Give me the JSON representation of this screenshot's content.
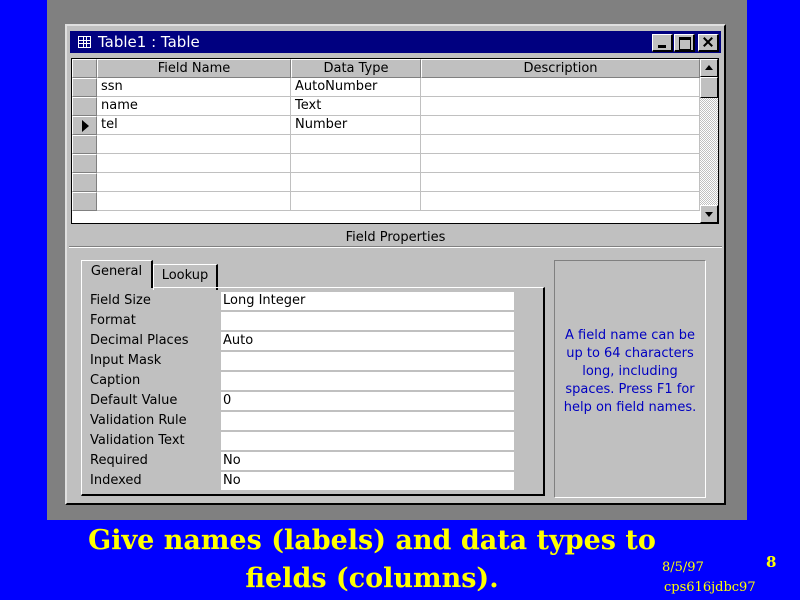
{
  "window": {
    "title": "Table1 : Table"
  },
  "grid": {
    "headers": [
      "Field Name",
      "Data Type",
      "Description"
    ],
    "rows": [
      {
        "field": "ssn",
        "type": "AutoNumber",
        "desc": ""
      },
      {
        "field": "name",
        "type": "Text",
        "desc": ""
      },
      {
        "field": "tel",
        "type": "Number",
        "desc": ""
      },
      {
        "field": "",
        "type": "",
        "desc": ""
      },
      {
        "field": "",
        "type": "",
        "desc": ""
      },
      {
        "field": "",
        "type": "",
        "desc": ""
      },
      {
        "field": "",
        "type": "",
        "desc": ""
      }
    ],
    "current_row": 2
  },
  "field_properties": {
    "label": "Field Properties",
    "tabs": [
      "General",
      "Lookup"
    ],
    "active_tab": "General",
    "props": [
      {
        "label": "Field Size",
        "value": "Long Integer"
      },
      {
        "label": "Format",
        "value": ""
      },
      {
        "label": "Decimal Places",
        "value": "Auto"
      },
      {
        "label": "Input Mask",
        "value": ""
      },
      {
        "label": "Caption",
        "value": ""
      },
      {
        "label": "Default Value",
        "value": "0"
      },
      {
        "label": "Validation Rule",
        "value": ""
      },
      {
        "label": "Validation Text",
        "value": ""
      },
      {
        "label": "Required",
        "value": "No"
      },
      {
        "label": "Indexed",
        "value": "No"
      }
    ],
    "help_text": "A field name can be up to 64 characters long, including spaces.  Press F1 for help on field names."
  },
  "slide": {
    "caption": "Give names (labels) and data types to fields (columns).",
    "date": "8/5/97",
    "course": "cps616jdbc97",
    "page": "8"
  },
  "colors": {
    "background": "#0000ff",
    "caption": "#ffff00",
    "titlebar": "#000080",
    "help_text": "#0000c0"
  }
}
